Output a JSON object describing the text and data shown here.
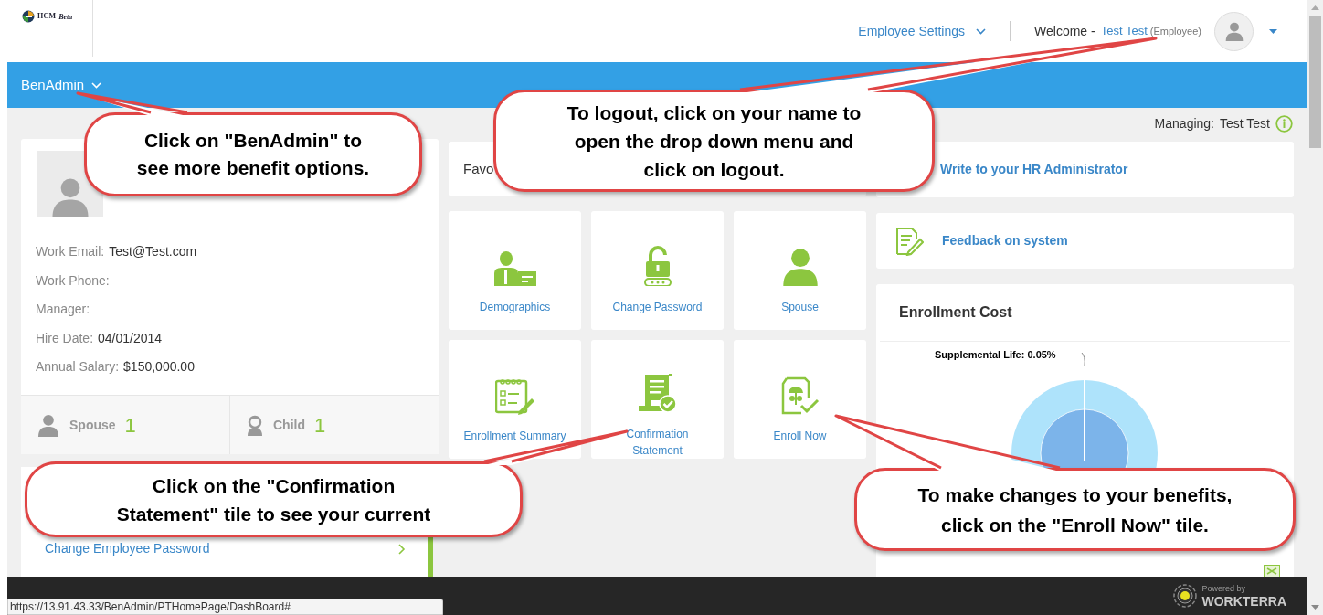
{
  "header": {
    "logo_text": "HCM",
    "logo_badge": "Beta",
    "settings_menu": "Employee Settings",
    "welcome": "Welcome -",
    "user_name": "Test Test",
    "user_role": "(Employee)"
  },
  "nav": {
    "menu": "BenAdmin"
  },
  "managing": {
    "label": "Managing:",
    "name": "Test Test"
  },
  "profile": {
    "fields": [
      {
        "label": "Work Email:",
        "value": "Test@Test.com"
      },
      {
        "label": "Work Phone:"
      },
      {
        "label": "Manager:"
      },
      {
        "label": "Hire Date:",
        "value": "04/01/2014"
      },
      {
        "label": "Annual Salary:",
        "value": "$150,000.00"
      }
    ],
    "dependents": [
      {
        "kind": "spouse",
        "label": "Spouse",
        "count": "1"
      },
      {
        "kind": "child",
        "label": "Child",
        "count": "1"
      }
    ]
  },
  "links": [
    {
      "label": "Change Employee Password"
    }
  ],
  "favorites": {
    "title": "Favo"
  },
  "tiles": [
    {
      "kind": "demographics",
      "label": "Demographics"
    },
    {
      "kind": "password",
      "label": "Change Password"
    },
    {
      "kind": "spouse",
      "label": "Spouse"
    },
    {
      "kind": "summary",
      "label": "Enrollment Summary"
    },
    {
      "kind": "confirmation",
      "label": "Confirmation Statement"
    },
    {
      "kind": "enroll",
      "label": "Enroll Now"
    }
  ],
  "actions": [
    {
      "kind": "hr",
      "label": "Write to your HR Administrator"
    },
    {
      "kind": "feedback",
      "label": "Feedback on system"
    }
  ],
  "enrollment_cost": {
    "title": "Enrollment Cost",
    "chart_label": "Supplemental Life: 0.05%"
  },
  "footer": {
    "powered_by": "Powered by",
    "brand": "WORKTERRA"
  },
  "status_url": "https://13.91.43.33/BenAdmin/PTHomePage/DashBoard#",
  "callouts": [
    {
      "lines": [
        "Click on \"BenAdmin\" to",
        "see more benefit options."
      ]
    },
    {
      "lines": [
        "To logout, click on your name to",
        "open the drop down menu and",
        "click on logout."
      ]
    },
    {
      "lines": [
        "Click on the \"Confirmation",
        "Statement\" tile to see your current"
      ]
    },
    {
      "lines": [
        "To make changes to your benefits,",
        "click on the \"Enroll Now\" tile."
      ]
    }
  ]
}
